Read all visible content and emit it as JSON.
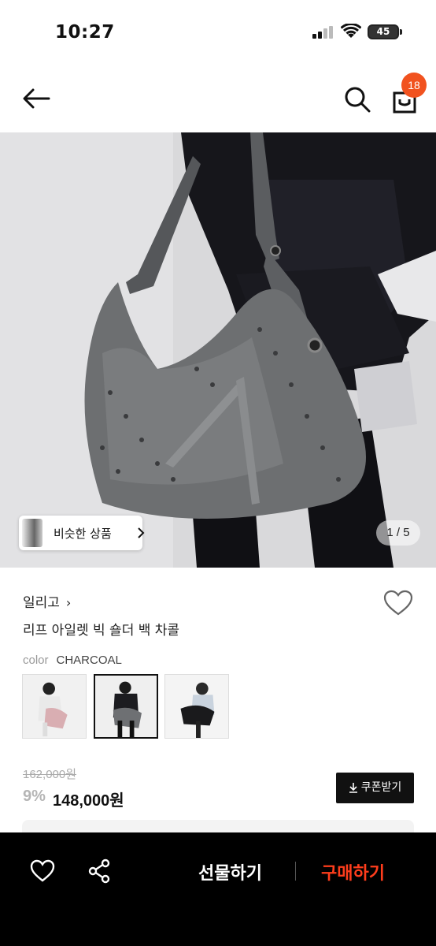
{
  "status_bar": {
    "time": "10:27",
    "battery": "45"
  },
  "header": {
    "cart_count": "18"
  },
  "hero": {
    "similar_label": "비슷한 상품",
    "counter": "1 / 5"
  },
  "product": {
    "brand": "일리고",
    "title": "리프 아일렛 빅 숄더 백 차콜",
    "color_label": "color",
    "color_value": "CHARCOAL",
    "original_price": "162,000원",
    "discount": "9%",
    "price": "148,000원",
    "coupon_label": "쿠폰받기"
  },
  "bottom_bar": {
    "gift_label": "선물하기",
    "buy_label": "구매하기"
  },
  "colors": {
    "accent": "#f1521f",
    "buy": "#ff3d1c",
    "dark": "#111111"
  },
  "icons": [
    "back-arrow-icon",
    "search-icon",
    "shopping-bag-icon",
    "heart-icon",
    "share-icon",
    "download-icon",
    "chevron-right-icon"
  ]
}
